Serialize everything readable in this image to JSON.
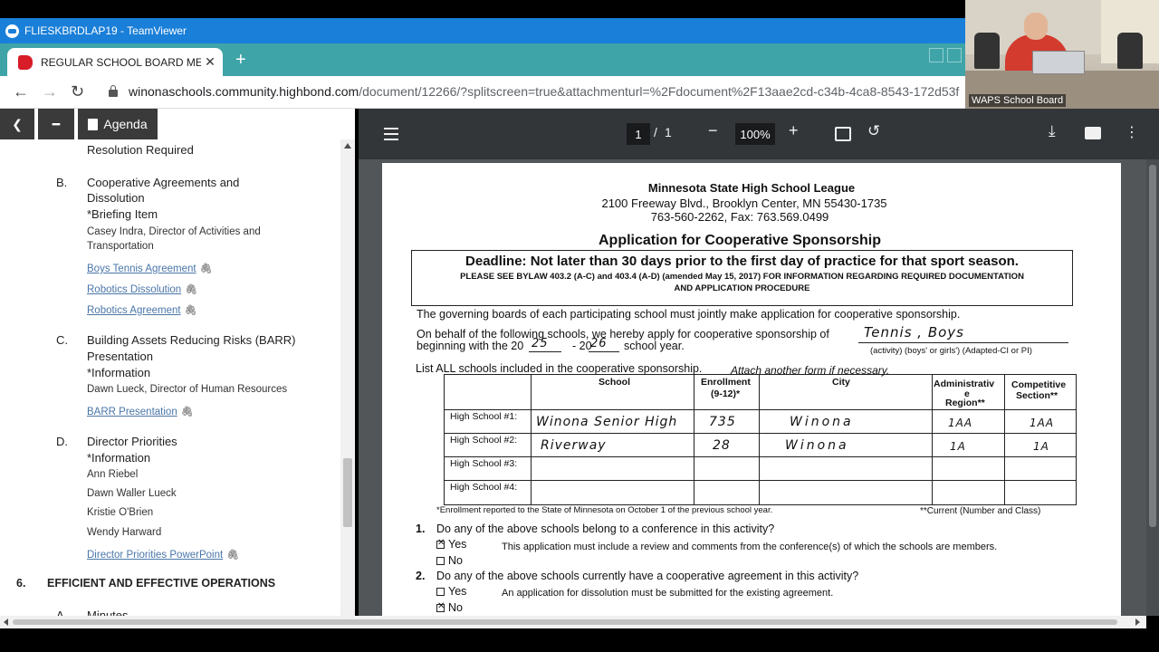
{
  "teamviewer": {
    "title": "FLIESKBRDLAP19 - TeamViewer"
  },
  "browser": {
    "tab_title": "REGULAR SCHOOL BOARD MEETI",
    "tab_close": "✕",
    "new_tab": "+",
    "url_host": "winonaschools.community.highbond.com",
    "url_path": "/document/12266/?splitscreen=true&attachmenturl=%2Fdocument%2F13aae2cd-c34b-4ca8-8543-172d53f"
  },
  "webcam": {
    "label": "WAPS School Board"
  },
  "agenda": {
    "agenda_label": "Agenda",
    "items": {
      "resolution_required": "Resolution Required",
      "b_letter": "B.",
      "b_title_1": "Cooperative Agreements and",
      "b_title_2": "Dissolution",
      "b_type": "*Briefing Item",
      "b_presenter_1": "Casey Indra, Director of Activities and",
      "b_presenter_2": "Transportation",
      "b_link_1": "Boys Tennis Agreement",
      "b_link_2": "Robotics Dissolution",
      "b_link_3": "Robotics Agreement",
      "c_letter": "C.",
      "c_title_1": "Building Assets Reducing Risks (BARR)",
      "c_title_2": "Presentation",
      "c_type": "*Information",
      "c_presenter": "Dawn Lueck, Director of Human Resources",
      "c_link": "BARR Presentation",
      "d_letter": "D.",
      "d_title": "Director Priorities",
      "d_type": "*Information",
      "d_person_1": "Ann Riebel",
      "d_person_2": "Dawn Waller Lueck",
      "d_person_3": "Kristie O'Brien",
      "d_person_4": "Wendy Harward",
      "d_link": "Director Priorities PowerPoint",
      "section_number": "6.",
      "section_title": "EFFICIENT AND EFFECTIVE OPERATIONS",
      "a_letter": "A.",
      "a_title": "Minutes"
    }
  },
  "pdf": {
    "current_page": "1",
    "page_sep": "/",
    "total_pages": "1",
    "zoom": "100%",
    "zoom_out": "−",
    "zoom_in": "+",
    "doc": {
      "org": "Minnesota State High School League",
      "address": "2100 Freeway Blvd., Brooklyn Center, MN 55430-1735",
      "phone": "763-560-2262, Fax: 763.569.0499",
      "title": "Application for Cooperative Sponsorship",
      "deadline": "Deadline:  Not later than 30 days prior to the first day of practice for that sport season.",
      "bylaw_1": "PLEASE SEE BYLAW 403.2 (A-C) and 403.4 (A-D) (amended May 15, 2017) FOR INFORMATION REGARDING REQUIRED DOCUMENTATION",
      "bylaw_2": "AND APPLICATION PROCEDURE",
      "governing": "The governing boards of each participating school must jointly make application for cooperative sponsorship.",
      "on_behalf": "On behalf of the following schools, we hereby apply for cooperative sponsorship of",
      "activity": "Tennis , Boys",
      "beginning": "beginning with the 20",
      "year_1": "25",
      "year_dash": "- 20",
      "year_2": "26",
      "school_year": "school year.",
      "activity_note": "(activity)  (boys' or girls')  (Adapted-CI or PI)",
      "list_all": "List ALL schools included in the cooperative sponsorship.",
      "attach": "Attach another form if necessary.",
      "col_school": "School",
      "col_enroll_1": "Enrollment",
      "col_enroll_2": "(9-12)*",
      "col_city": "City",
      "col_admin_1": "Administrativ",
      "col_admin_2": "e",
      "col_admin_3": "Region**",
      "col_comp_1": "Competitive",
      "col_comp_2": "Section**",
      "row_1": "High School #1:",
      "row_2": "High School #2:",
      "row_3": "High School #3:",
      "row_4": "High School #4:",
      "r1_school": "Winona Senior High",
      "r1_enroll": "735",
      "r1_city": "Winona",
      "r1_admin": "1AA",
      "r1_comp": "1AA",
      "r2_school": "Riverway",
      "r2_enroll": "28",
      "r2_city": "Winona",
      "r2_admin": "1A",
      "r2_comp": "1A",
      "enroll_note": "*Enrollment reported to the State of Minnesota on October 1 of the previous school year.",
      "current_note": "**Current (Number and Class)",
      "q1_num": "1.",
      "q1": "Do any of the above schools belong to a conference in this activity?",
      "q1_yes": "Yes",
      "q1_yes_note": "This application must include a review and comments from the conference(s) of which the schools are members.",
      "q1_no": "No",
      "q2_num": "2.",
      "q2": "Do any of the above schools currently have a cooperative agreement in this activity?",
      "q2_yes": "Yes",
      "q2_yes_note": "An application for dissolution must be submitted for the existing agreement.",
      "q2_no": "No",
      "check_mark": "✕"
    }
  }
}
